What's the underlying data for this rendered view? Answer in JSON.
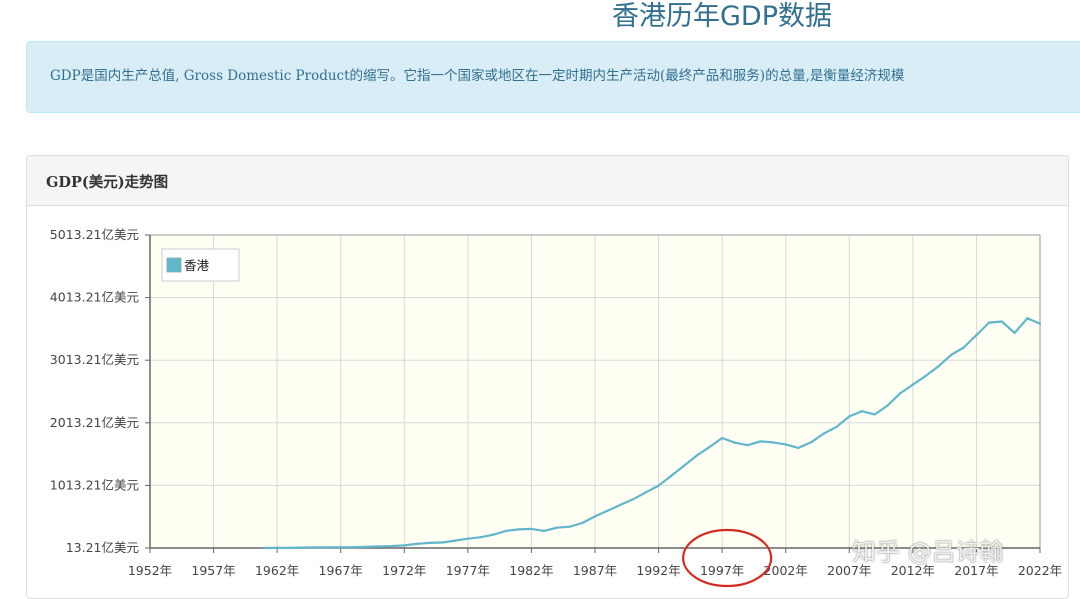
{
  "page": {
    "title": "香港历年GDP数据",
    "description": "GDP是国内生产总值, Gross Domestic Product的缩写。它指一个国家或地区在一定时期内生产活动(最终产品和服务)的总量,是衡量经济规模"
  },
  "panel": {
    "title": "GDP(美元)走势图"
  },
  "watermark": "知乎 @吕诗翰",
  "colors": {
    "series": "#62b6cc",
    "plot_bg": "#fffff4",
    "annotation": "#d42a1f",
    "grid": "#d8d8d8"
  },
  "chart_data": {
    "type": "line",
    "title": "",
    "xlabel": "",
    "ylabel": "",
    "x_tick_labels": [
      "1952年",
      "1957年",
      "1962年",
      "1967年",
      "1972年",
      "1977年",
      "1982年",
      "1987年",
      "1992年",
      "1997年",
      "2002年",
      "2007年",
      "2012年",
      "2017年",
      "2022年"
    ],
    "y_tick_labels": [
      "13.21亿美元",
      "1013.21亿美元",
      "2013.21亿美元",
      "3013.21亿美元",
      "4013.21亿美元",
      "5013.21亿美元"
    ],
    "x_range": [
      1952,
      2022
    ],
    "ylim": [
      13.21,
      5013.21
    ],
    "legend": {
      "position": "top-left",
      "entries": [
        "香港"
      ]
    },
    "grid": true,
    "annotation": {
      "type": "circle",
      "around_label": "1997年"
    },
    "series": [
      {
        "name": "香港",
        "x": [
          1961,
          1962,
          1963,
          1964,
          1965,
          1966,
          1967,
          1968,
          1969,
          1970,
          1971,
          1972,
          1973,
          1974,
          1975,
          1976,
          1977,
          1978,
          1979,
          1980,
          1981,
          1982,
          1983,
          1984,
          1985,
          1986,
          1987,
          1988,
          1989,
          1990,
          1991,
          1992,
          1993,
          1994,
          1995,
          1996,
          1997,
          1998,
          1999,
          2000,
          2001,
          2002,
          2003,
          2004,
          2005,
          2006,
          2007,
          2008,
          2009,
          2010,
          2011,
          2012,
          2013,
          2014,
          2015,
          2016,
          2017,
          2018,
          2019,
          2020,
          2021,
          2022
        ],
        "values": [
          13,
          15,
          17,
          20,
          22,
          24,
          25,
          26,
          30,
          38,
          44,
          54,
          80,
          95,
          101,
          131,
          162,
          185,
          225,
          287,
          310,
          319,
          287,
          338,
          354,
          413,
          518,
          610,
          702,
          791,
          903,
          1010,
          1166,
          1326,
          1489,
          1625,
          1770,
          1696,
          1656,
          1716,
          1700,
          1668,
          1613,
          1701,
          1843,
          1949,
          2115,
          2198,
          2148,
          2286,
          2483,
          2624,
          2761,
          2914,
          3095,
          3216,
          3414,
          3614,
          3631,
          3449,
          3682,
          3598
        ]
      }
    ]
  }
}
